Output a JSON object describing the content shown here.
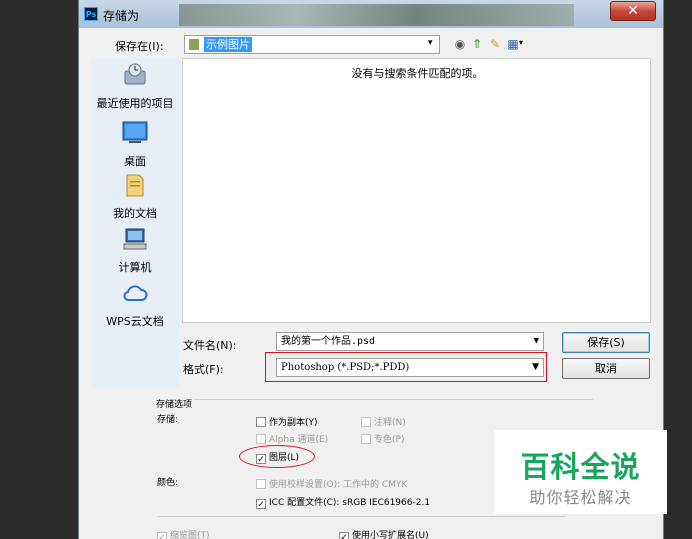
{
  "window": {
    "title": "存储为",
    "app_icon": "Ps",
    "close_glyph": "✕"
  },
  "header": {
    "save_in_label": "保存在(I):",
    "folder": "示例图片"
  },
  "toolbar": {
    "back": "◉",
    "up": "⇑",
    "new_folder": "✎",
    "view": "▦",
    "view_arrow": "▾",
    "combo_arrow": "▾"
  },
  "places": [
    {
      "label": "最近使用的项目",
      "icon": "recent-icon"
    },
    {
      "label": "桌面",
      "icon": "desktop-icon"
    },
    {
      "label": "我的文档",
      "icon": "documents-icon"
    },
    {
      "label": "计算机",
      "icon": "computer-icon"
    },
    {
      "label": "WPS云文档",
      "icon": "cloud-icon"
    }
  ],
  "file_list": {
    "empty_message": "没有与搜索条件匹配的项。"
  },
  "form": {
    "filename_label": "文件名(N):",
    "filename_value": "我的第一个作品.psd",
    "format_label": "格式(F):",
    "format_value": "Photoshop (*.PSD;*.PDD)",
    "arrow": "▼"
  },
  "buttons": {
    "save": "保存(S)",
    "cancel": "取消"
  },
  "options": {
    "section_title": "存储选项",
    "save_label": "存储:",
    "as_copy": "作为副本(Y)",
    "notes": "注释(N)",
    "alpha": "Alpha 通道(E)",
    "spot": "专色(P)",
    "layers": "图层(L)",
    "color_label": "颜色:",
    "proof": "使用校样设置(O): 工作中的 CMYK",
    "icc": "ICC 配置文件(C): sRGB IEC61966-2.1",
    "thumbnail": "缩览图(T)",
    "lowercase_ext": "使用小写扩展名(U)",
    "check_glyph": "✓"
  },
  "watermark": {
    "title": "百科全说",
    "subtitle": "助你轻松解决"
  },
  "colors": {
    "highlight_red": "#d8141b",
    "watermark_green": "#19a65c",
    "selection_blue": "#3399ff"
  }
}
